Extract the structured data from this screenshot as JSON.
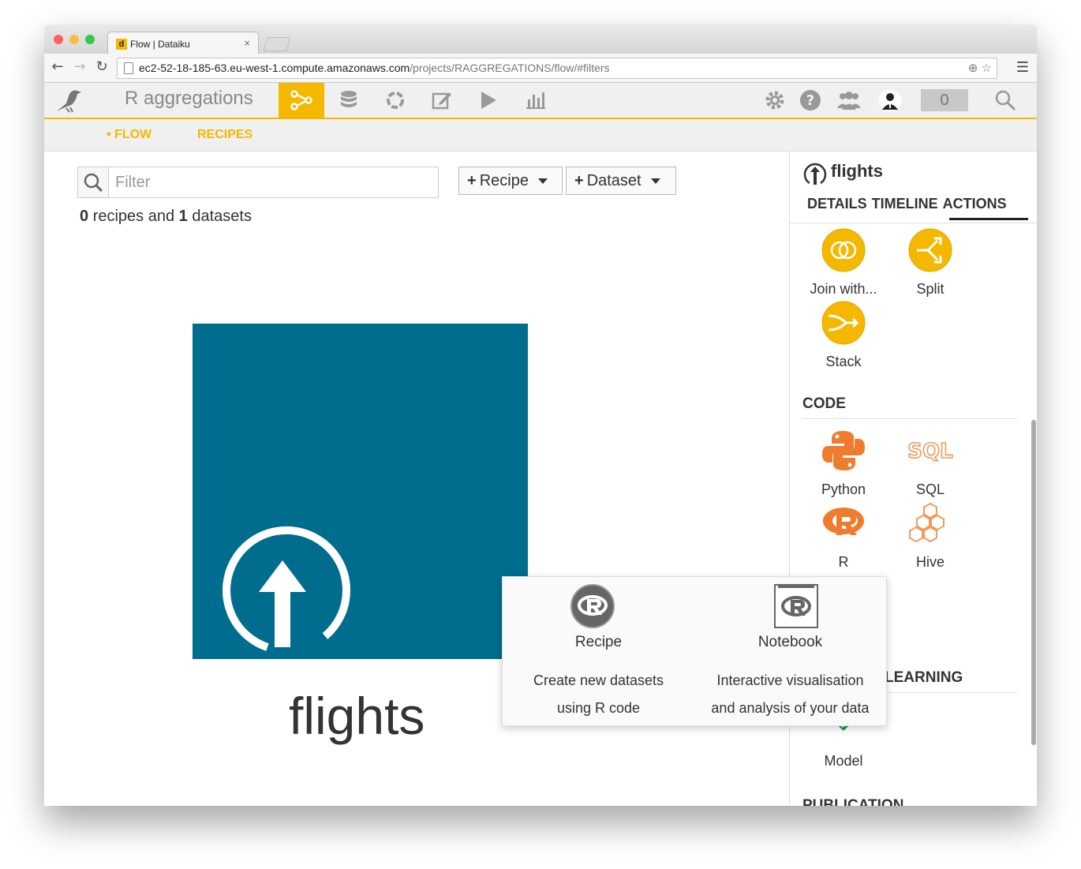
{
  "browser": {
    "tab_title": "Flow | Dataiku",
    "tab_favicon": "d",
    "tab_close": "×",
    "url_host": "ec2-52-18-185-63.eu-west-1.compute.amazonaws.com",
    "url_path": "/projects/RAGGREGATIONS/flow/#filters"
  },
  "app": {
    "project_name": "R aggregations",
    "accent": "#f5b800",
    "nav_icons": [
      "flow-icon",
      "datasets-icon",
      "recipes-icon",
      "notebooks-icon",
      "jobs-icon",
      "dashboards-icon"
    ],
    "notification_count": "0"
  },
  "subnav": {
    "flow_label": "• FLOW",
    "recipes_label": "RECIPES"
  },
  "main": {
    "filter_placeholder": "Filter",
    "recipe_button": "Recipe",
    "dataset_button": "Dataset",
    "recipes_count": "0",
    "recipes_text": "recipes and",
    "datasets_count": "1",
    "datasets_text": "datasets",
    "dataset_name": "flights",
    "dataset_color": "#006d8f"
  },
  "right_panel": {
    "title": "flights",
    "tabs": [
      "DETAILS",
      "TIMELINE",
      "ACTIONS"
    ],
    "visual_actions": [
      {
        "label": "Join with..."
      },
      {
        "label": "Split"
      },
      {
        "label": "Stack"
      }
    ],
    "code_section": "CODE",
    "code_actions": [
      {
        "label": "Python"
      },
      {
        "label": "SQL"
      },
      {
        "label": "R"
      },
      {
        "label": "Hive"
      }
    ],
    "ml_section": "LEARNING",
    "ml_actions": [
      {
        "label": "Model"
      }
    ],
    "publication_section": "PUBLICATION"
  },
  "popup": {
    "items": [
      {
        "name": "Recipe",
        "desc_line1": "Create new datasets",
        "desc_line2": "using R code"
      },
      {
        "name": "Notebook",
        "desc_line1": "Interactive visualisation",
        "desc_line2": "and analysis of your data"
      }
    ]
  }
}
